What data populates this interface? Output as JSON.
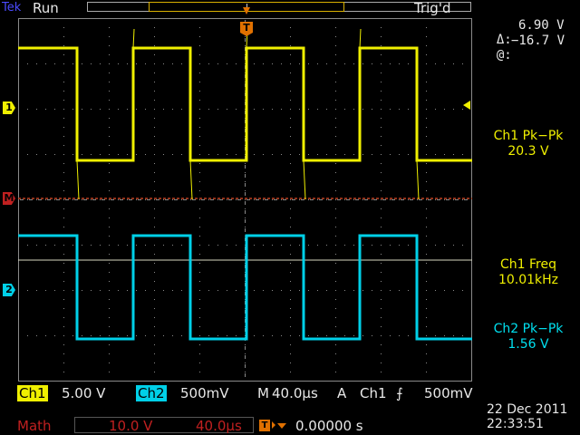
{
  "header": {
    "brand": "Tek",
    "run_state": "Run",
    "trigger_state": "Trig'd"
  },
  "cursor": {
    "delta_label": "Δ:",
    "delta_value": "6.90 V",
    "at_label": "@:",
    "at_value": "−16.7 V"
  },
  "measurements": [
    {
      "name": "Ch1 Pk−Pk",
      "value": "20.3 V",
      "color": "#f0f000"
    },
    {
      "name": "Ch1 Freq",
      "value": "10.01kHz",
      "color": "#f0f000"
    },
    {
      "name": "Ch2 Pk−Pk",
      "value": "1.56 V",
      "color": "#00e0f0"
    }
  ],
  "markers": {
    "ch1": "1",
    "math": "M",
    "ch2": "2",
    "trigger": "T"
  },
  "status": {
    "ch1_label": "Ch1",
    "ch1_scale": "5.00 V",
    "ch2_label": "Ch2",
    "ch2_scale": "500mV",
    "timebase_label": "M",
    "timebase": "40.0µs",
    "trigger_mode": "A",
    "trigger_source": "Ch1",
    "trigger_slope": "⨍",
    "trigger_level": "500mV",
    "math_label": "Math",
    "math_scale": "10.0 V",
    "math_time": "40.0µs",
    "trigger_delay": "0.00000 s",
    "date": "22 Dec 2011",
    "time": "22:33:51"
  },
  "colors": {
    "ch1": "#f0f000",
    "ch2": "#00d0e8",
    "math": "#c02020",
    "grid": "#8a8a8a"
  }
}
